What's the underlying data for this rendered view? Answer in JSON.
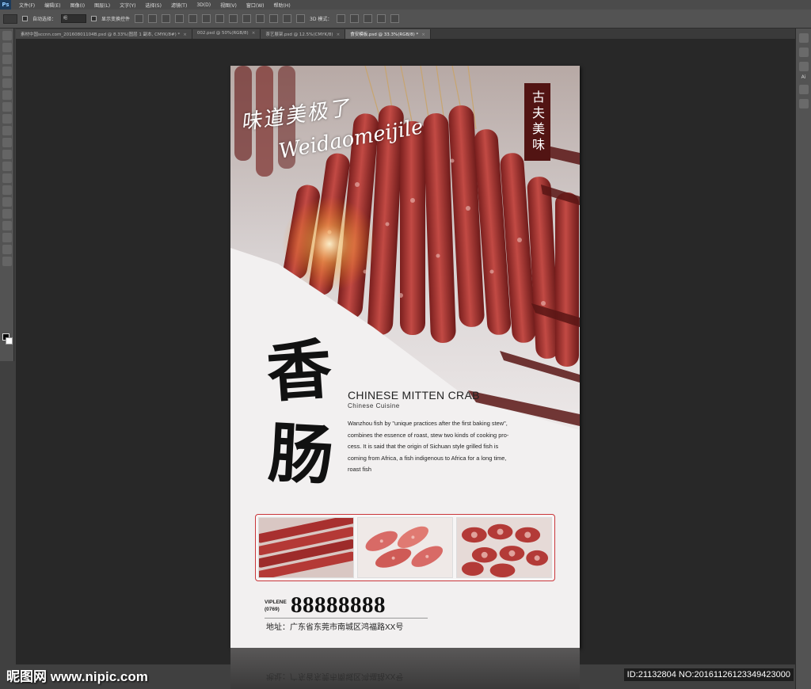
{
  "app": {
    "logo": "Ps",
    "menu": [
      "文件(F)",
      "编辑(E)",
      "图像(I)",
      "图层(L)",
      "文字(Y)",
      "选择(S)",
      "滤镜(T)",
      "3D(D)",
      "视图(V)",
      "窗口(W)",
      "帮助(H)"
    ]
  },
  "options": {
    "auto_select_label": "自动选择：",
    "auto_select_value": "组",
    "show_transform_label": "显示变换控件",
    "mode_3d_label": "3D 模式："
  },
  "tabs": [
    {
      "label": "素材中国sccnn.com_20160801104B.psd @ 8.33%(图层 1 副本, CMYK/8#) *"
    },
    {
      "label": "002.psd @ 50%(RGB/8)"
    },
    {
      "label": "茶艺展架.psd @ 12.5%(CMYK/8)"
    },
    {
      "label": "食安模板.psd @ 33.3%(RGB/8) *"
    }
  ],
  "right_panel": {
    "ai_label": "Ai"
  },
  "poster": {
    "script_cn": "味道美极了",
    "script_en": "Weidaomeijile",
    "badge": "古夫美味",
    "big_char_1": "香",
    "big_char_2": "肠",
    "en_title": "CHINESE MITTEN CRAB",
    "en_subtitle": "Chinese  Cuisine",
    "body_lines": [
      "Wanzhou fish by \"unique practices after the first baking stew\",",
      "combines the essence of roast, stew two kinds of cooking pro-",
      "cess. It is said that the origin of Sichuan style grilled fish is",
      "coming from Africa, a fish indigenous to Africa for a long time,",
      "roast fish"
    ],
    "phone_label_1": "VIPLENE",
    "phone_label_2": "(0769)",
    "phone_number": "88888888",
    "address": "地址：广东省东莞市南城区鸿福路XX号"
  },
  "watermark": {
    "left": "昵图网 www.nipic.com",
    "right": "ID:21132804 NO:20161126123349423000"
  },
  "colors": {
    "badge": "#521413",
    "frame": "#c9363a",
    "sausage": "#a8302f"
  }
}
